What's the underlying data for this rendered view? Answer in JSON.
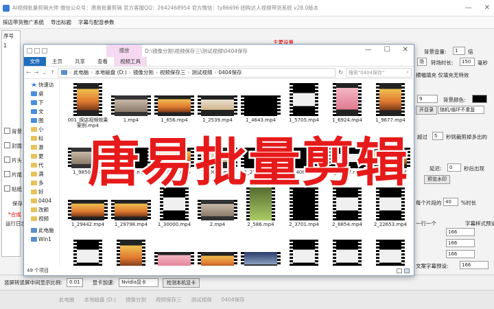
{
  "app": {
    "title": "AI视频批量剪辑大师  微信公众号：唐易批量剪辑  官方客服QQ：2642468954  官方微信：ty86696  团购达人视频带货系统  v28.0版本",
    "menu": [
      "採店带货推广系统",
      "导出标题",
      "字幕与配音参数"
    ]
  },
  "background": {
    "seq_header": "序号",
    "seq_value": "1",
    "main_settings": "主要设置",
    "left_labels": [
      "背景",
      "封面",
      "片头",
      "片尾",
      "贴纸",
      "保存",
      "*合成",
      "运行日志"
    ],
    "right": {
      "bg_volume_label": "背景音量:",
      "bg_volume_value": "1",
      "bg_volume_unit": "倍",
      "duration_label": "转场时长:",
      "duration_value": "150",
      "duration_unit": "毫秒",
      "scale_option": "横幅填充 仅填充无特效",
      "bg_color_label": "背景颜色:",
      "num_9": "9",
      "open_dir_button": "开目录",
      "random_loop": "随机/循环不重复",
      "over_label": "超过",
      "over_value": "5",
      "over_text": "秒则裁剪掉多出的",
      "delay_label": "延迟:",
      "delay_value": "0",
      "delay_unit": "秒后出现",
      "preview_watermark_button": "预览水印",
      "per_clip_label": "每个片段的",
      "per_clip_value": "40",
      "per_clip_unit": "%时长",
      "one_line_label": "一行一个",
      "subtitle_preset_label": "字幕样式预设",
      "preset_a": "166",
      "preset_b": "166",
      "preset_c": "166",
      "preset_d": "166",
      "preset_e": "166",
      "subtitle_preset2": "文案字幕预设:"
    },
    "bottom": {
      "ratio_label": "竖屏转竖屏中间显示比例:",
      "ratio_value": "0.01",
      "gpu_label": "显卡加速:",
      "gpu_value": "Nvidia显卡",
      "detect_button": "检测本机显卡",
      "faded": [
        "此电脑",
        "本地磁盘 (D:)",
        "镜像分割",
        "视频保存三",
        "测试视频",
        "0404保存"
      ]
    }
  },
  "explorer": {
    "play_tab": "播放",
    "title_path": "D:\\镜像分割\\视频保存三\\测试视频\\0404保存",
    "ribbon_tabs": [
      "文件",
      "主页",
      "共享",
      "查看",
      "视频工具"
    ],
    "breadcrumb": [
      "此电脑",
      "本地磁盘 (D:)",
      "镜像分割",
      "视频保存三",
      "测试视频",
      "0404保存"
    ],
    "search_placeholder": "搜索\"0404保存\"",
    "nav_items": [
      "快速访",
      "桌",
      "下",
      "文",
      "图",
      "小",
      "标",
      "激",
      "更",
      "代",
      "满",
      "多",
      "好",
      "0404",
      "改颜",
      "视频",
      "此电脑",
      "Win1"
    ],
    "status": "49 个项目",
    "files": [
      {
        "name": "001_探店视频效果案例.mp4",
        "frame": "drink",
        "wide": false
      },
      {
        "name": "1.mp4",
        "frame": "group",
        "wide": true
      },
      {
        "name": "1_656.mp4",
        "frame": "drink",
        "wide": true
      },
      {
        "name": "1_2539.mp4",
        "frame": "cup",
        "wide": true
      },
      {
        "name": "1_4643.mp4",
        "frame": "dark",
        "wide": true
      },
      {
        "name": "1_5705.mp4",
        "frame": "darkband",
        "wide": false
      },
      {
        "name": "1_6924.mp4",
        "frame": "pink",
        "wide": false
      },
      {
        "name": "1_9677.mp4",
        "frame": "drink",
        "wide": false
      },
      {
        "name": "1_9850.mp4",
        "frame": "group",
        "wide": true
      },
      {
        "name": "1_12122.mp4",
        "frame": "dark",
        "wide": true
      },
      {
        "name": "1_13839.mp4",
        "frame": "drink",
        "wide": true
      },
      {
        "name": "1_20639.mp4",
        "frame": "cup",
        "wide": true
      },
      {
        "name": "1_23874.mp4",
        "frame": "dark",
        "wide": true
      },
      {
        "name": "1_24085.mp4",
        "frame": "dark",
        "wide": true
      },
      {
        "name": "1_25917.mp4",
        "frame": "darkband",
        "wide": true
      },
      {
        "name": "1_26809.mp4",
        "frame": "drink",
        "wide": true
      },
      {
        "name": "1_29442.mp4",
        "frame": "drink",
        "wide": true
      },
      {
        "name": "1_29798.mp4",
        "frame": "drink",
        "wide": true
      },
      {
        "name": "1_30000.mp4",
        "frame": "darkband",
        "wide": false
      },
      {
        "name": "2.mp4",
        "frame": "group",
        "wide": true
      },
      {
        "name": "2_586.mp4",
        "frame": "green",
        "wide": false
      },
      {
        "name": "2_3701.mp4",
        "frame": "dark",
        "wide": false
      },
      {
        "name": "2_6854.mp4",
        "frame": "darkband",
        "wide": false
      },
      {
        "name": "2_22653.mp4",
        "frame": "darkband",
        "wide": false
      },
      {
        "name": "",
        "frame": "darkband",
        "wide": false
      },
      {
        "name": "",
        "frame": "drink",
        "wide": false
      },
      {
        "name": "",
        "frame": "pink",
        "wide": true
      },
      {
        "name": "",
        "frame": "drink",
        "wide": true
      },
      {
        "name": "",
        "frame": "street",
        "wide": true
      },
      {
        "name": "",
        "frame": "darkband",
        "wide": false
      },
      {
        "name": "",
        "frame": "darkband",
        "wide": false
      },
      {
        "name": "",
        "frame": "darkband",
        "wide": false
      }
    ]
  },
  "overlay_text": "唐易批量剪辑"
}
